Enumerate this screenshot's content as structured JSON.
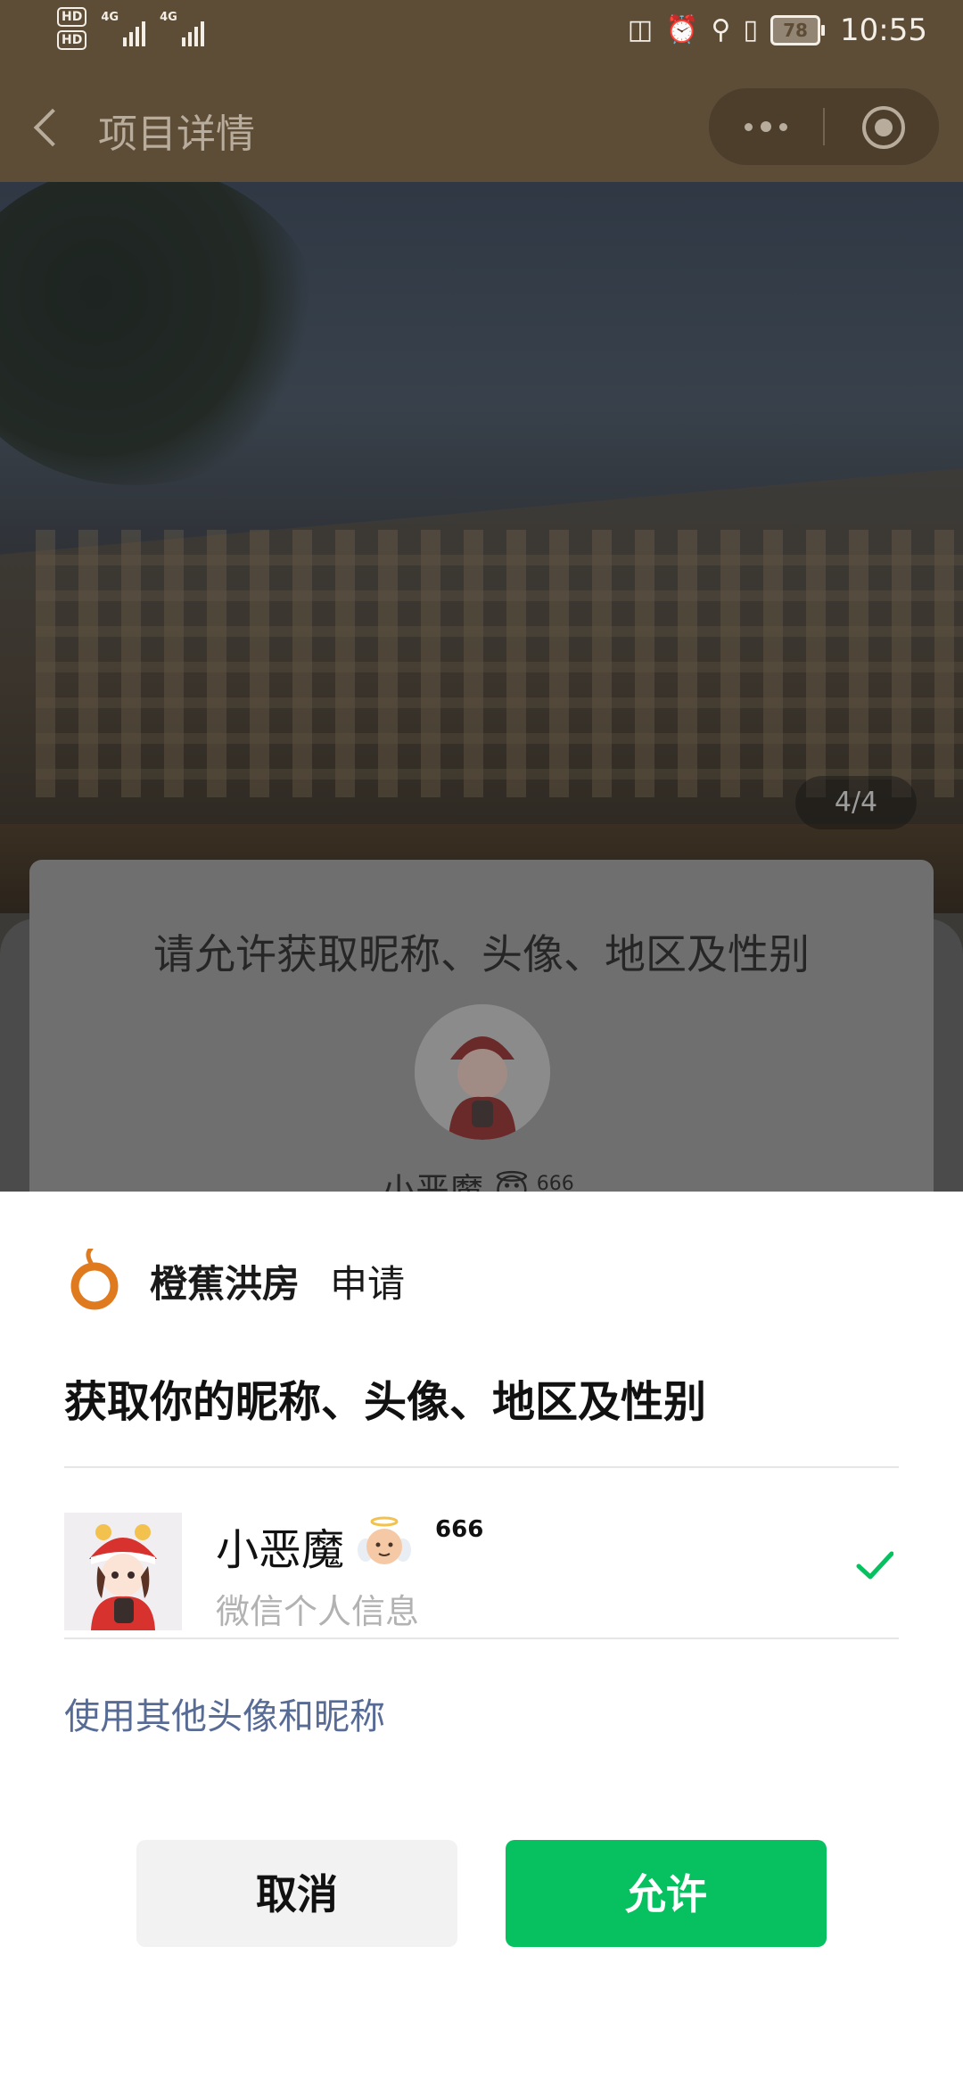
{
  "status_bar": {
    "hd1": "HD",
    "hd2": "HD",
    "net1": "4G",
    "net2": "4G",
    "battery": "78",
    "time": "10:55"
  },
  "nav": {
    "title": "项目详情"
  },
  "hero": {
    "counter": "4/4"
  },
  "background_dialog": {
    "title": "请允许获取昵称、头像、地区及性别",
    "nickname": "小恶魔",
    "nickname_sup": "666"
  },
  "sheet": {
    "app_name": "橙蕉洪房",
    "app_action": "申请",
    "title": "获取你的昵称、头像、地区及性别",
    "profile": {
      "nickname": "小恶魔",
      "nickname_sup": "666",
      "subtitle": "微信个人信息"
    },
    "alt_link": "使用其他头像和昵称",
    "cancel_label": "取消",
    "allow_label": "允许"
  },
  "colors": {
    "nav_bg": "#5e4d36",
    "link": "#576b95",
    "allow_green": "#07c160",
    "check_green": "#07c160",
    "brand_orange": "#e07a1f"
  },
  "icons": [
    "back-chevron-icon",
    "more-dots-icon",
    "close-target-icon",
    "orange-logo-icon",
    "angel-emoji-icon",
    "checkmark-icon"
  ]
}
